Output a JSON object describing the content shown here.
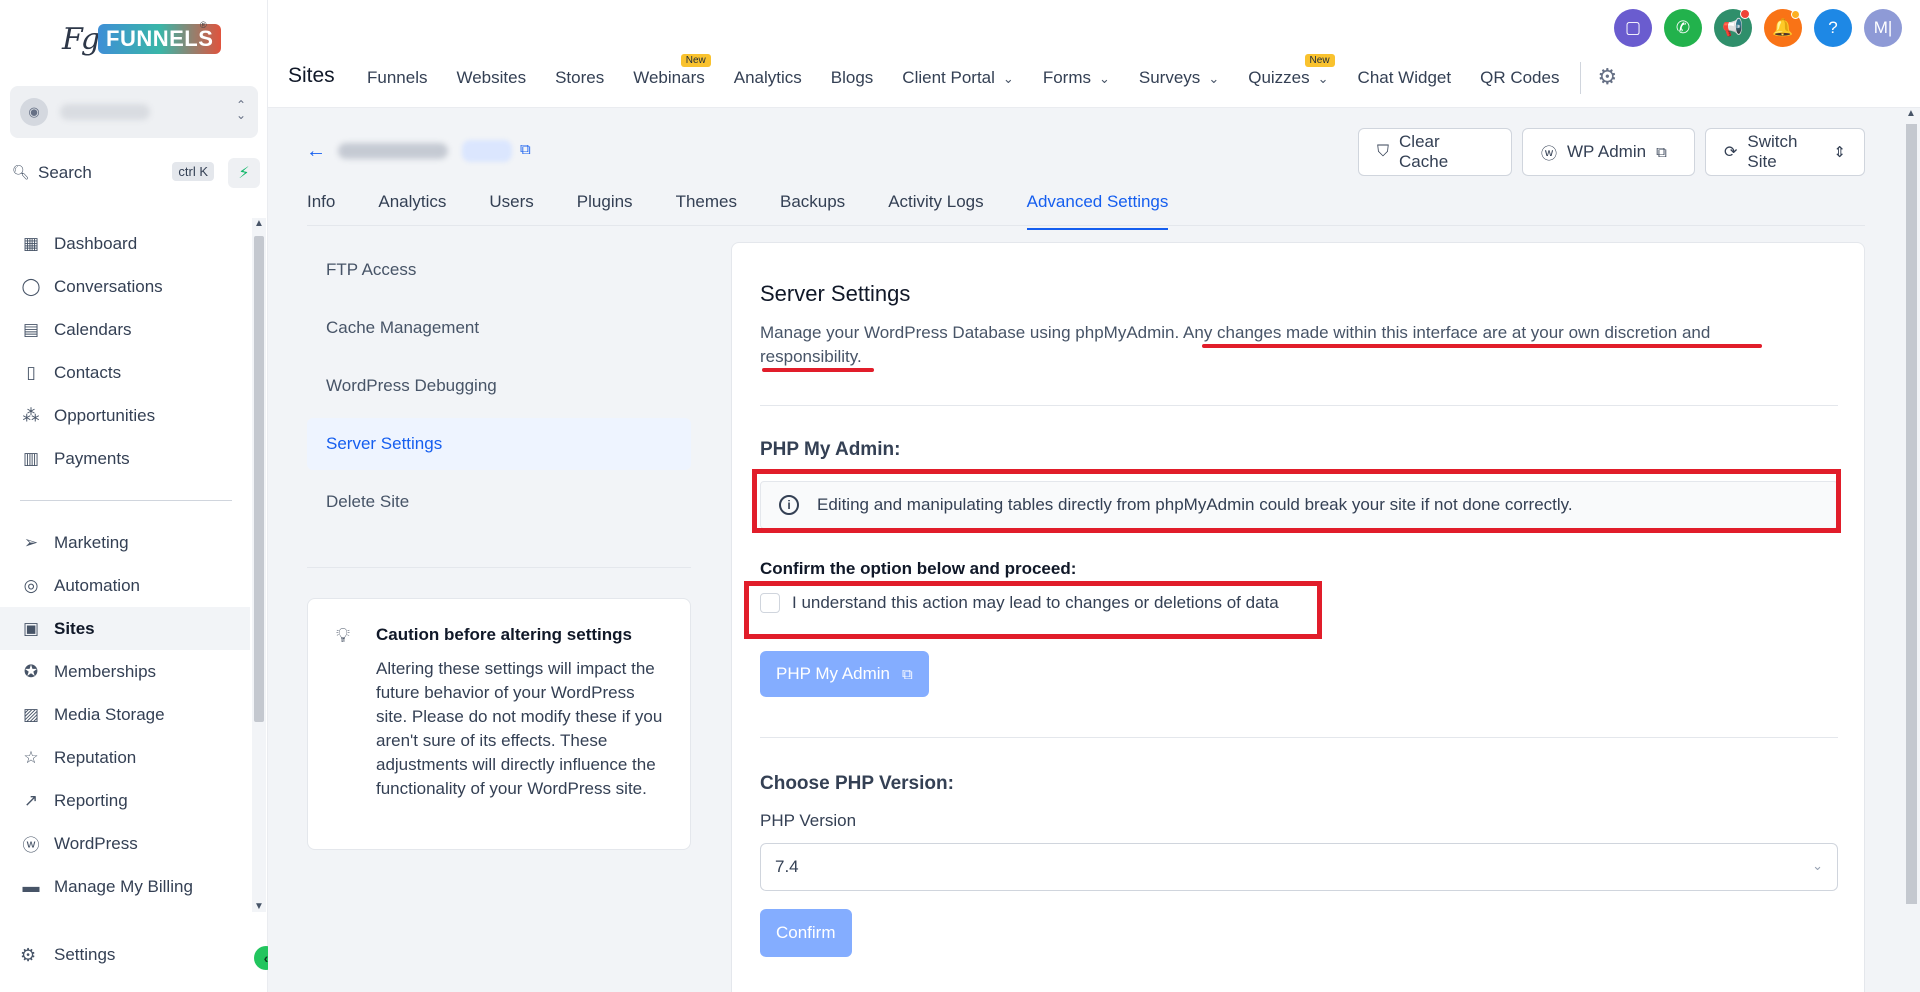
{
  "brand": {
    "logo_mark": "Fg",
    "logo_text": "FUNNELS",
    "logo_reg": "®"
  },
  "account": {
    "switcher_icon": "chevron-up-down-icon"
  },
  "search": {
    "label": "Search",
    "shortcut": "ctrl K"
  },
  "sidebar": {
    "items_top": [
      {
        "label": "Dashboard",
        "icon": "dashboard-icon",
        "glyph": "▦"
      },
      {
        "label": "Conversations",
        "icon": "chat-icon",
        "glyph": "◯"
      },
      {
        "label": "Calendars",
        "icon": "calendar-icon",
        "glyph": "▤"
      },
      {
        "label": "Contacts",
        "icon": "contacts-icon",
        "glyph": "▯"
      },
      {
        "label": "Opportunities",
        "icon": "opportunities-icon",
        "glyph": "⁂"
      },
      {
        "label": "Payments",
        "icon": "payments-icon",
        "glyph": "▥"
      }
    ],
    "items_bottom": [
      {
        "label": "Marketing",
        "icon": "send-icon",
        "glyph": "➢"
      },
      {
        "label": "Automation",
        "icon": "automation-icon",
        "glyph": "◎"
      },
      {
        "label": "Sites",
        "icon": "sites-icon",
        "glyph": "▣",
        "active": true
      },
      {
        "label": "Memberships",
        "icon": "memberships-icon",
        "glyph": "✪"
      },
      {
        "label": "Media Storage",
        "icon": "media-icon",
        "glyph": "▨"
      },
      {
        "label": "Reputation",
        "icon": "star-icon",
        "glyph": "☆"
      },
      {
        "label": "Reporting",
        "icon": "reporting-icon",
        "glyph": "↗"
      },
      {
        "label": "WordPress",
        "icon": "wordpress-icon",
        "glyph": "ⓦ"
      },
      {
        "label": "Manage My Billing",
        "icon": "billing-icon",
        "glyph": "▬"
      }
    ],
    "settings_label": "Settings"
  },
  "topbar": {
    "title": "Sites",
    "nav": [
      {
        "label": "Funnels"
      },
      {
        "label": "Websites"
      },
      {
        "label": "Stores"
      },
      {
        "label": "Webinars",
        "badge": "New"
      },
      {
        "label": "Analytics"
      },
      {
        "label": "Blogs"
      },
      {
        "label": "Client Portal",
        "dropdown": true
      },
      {
        "label": "Forms",
        "dropdown": true
      },
      {
        "label": "Surveys",
        "dropdown": true
      },
      {
        "label": "Quizzes",
        "dropdown": true,
        "badge": "New"
      },
      {
        "label": "Chat Widget"
      },
      {
        "label": "QR Codes"
      }
    ],
    "icons": [
      {
        "name": "messages-icon",
        "glyph": "▢",
        "color": "#6a5ccf"
      },
      {
        "name": "phone-icon",
        "glyph": "✆",
        "color": "#22b24c"
      },
      {
        "name": "megaphone-icon",
        "glyph": "📢",
        "color": "#2f8f6b",
        "dot": "red"
      },
      {
        "name": "bell-icon",
        "glyph": "🔔",
        "color": "#f97316",
        "dot": "orange"
      },
      {
        "name": "help-icon",
        "glyph": "?",
        "color": "#1e88e5"
      },
      {
        "name": "user-avatar",
        "glyph": "M|",
        "color": "#8e9ad6"
      }
    ]
  },
  "header_buttons": {
    "clear_cache": "Clear Cache",
    "wp_admin": "WP Admin",
    "switch_site": "Switch Site"
  },
  "tabs": [
    {
      "label": "Info"
    },
    {
      "label": "Analytics"
    },
    {
      "label": "Users"
    },
    {
      "label": "Plugins"
    },
    {
      "label": "Themes"
    },
    {
      "label": "Backups"
    },
    {
      "label": "Activity Logs"
    },
    {
      "label": "Advanced Settings",
      "active": true
    }
  ],
  "subnav": [
    {
      "label": "FTP Access"
    },
    {
      "label": "Cache Management"
    },
    {
      "label": "WordPress Debugging"
    },
    {
      "label": "Server Settings",
      "active": true
    },
    {
      "label": "Delete Site"
    }
  ],
  "caution": {
    "title": "Caution before altering settings",
    "text": "Altering these settings will impact the future behavior of your WordPress site. Please do not modify these if you aren't sure of its effects. These adjustments will directly influence the functionality of your WordPress site."
  },
  "server_settings": {
    "title": "Server Settings",
    "desc_part1": "Manage your WordPress Database using phpMyAdmin. ",
    "desc_part2": "Any changes made within this interface are at your own discretion and responsibility.",
    "pma_heading": "PHP My Admin:",
    "alert_text": "Editing and manipulating tables directly from phpMyAdmin could break your site if not done correctly.",
    "confirm_label": "Confirm the option below and proceed:",
    "checkbox_label": "I understand this action may lead to changes or deletions of data",
    "checkbox_checked": false,
    "pma_button": "PHP My Admin",
    "php_heading": "Choose PHP Version:",
    "php_version_label": "PHP Version",
    "php_version_value": "7.4",
    "confirm_button": "Confirm"
  },
  "colors": {
    "accent": "#155eef",
    "annotation_red": "#e11d2a",
    "disabled_button": "#84adff"
  }
}
